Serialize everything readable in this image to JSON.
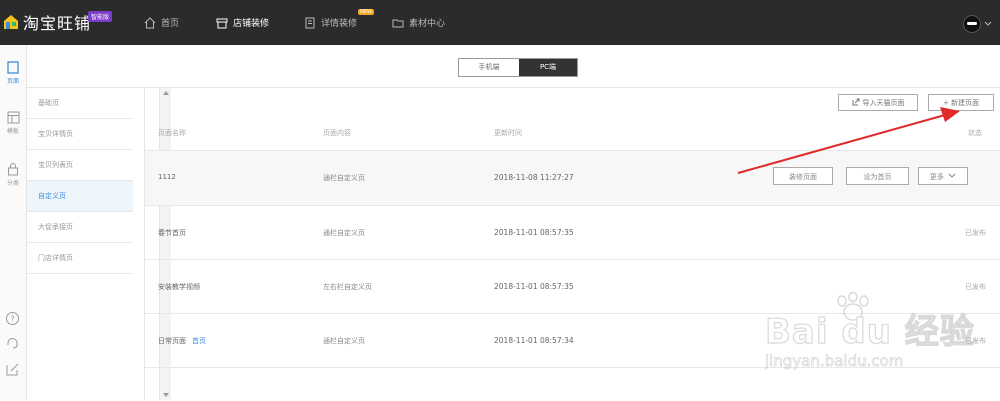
{
  "brand": {
    "name": "淘宝旺铺",
    "badge": "智能版"
  },
  "topnav": [
    {
      "label": "首页",
      "icon": "home-icon",
      "active": false
    },
    {
      "label": "店铺装修",
      "icon": "store-icon",
      "active": true
    },
    {
      "label": "详情装修",
      "icon": "document-icon",
      "active": false,
      "badge": "NEW"
    },
    {
      "label": "素材中心",
      "icon": "folder-icon",
      "active": false
    }
  ],
  "rail": [
    {
      "label": "页面",
      "icon": "page-icon",
      "active": true
    },
    {
      "label": "模板",
      "icon": "template-icon",
      "active": false
    },
    {
      "label": "分类",
      "icon": "bag-icon",
      "active": false
    }
  ],
  "rail_bottom_icons": [
    "help-icon",
    "headset-icon",
    "edit-icon"
  ],
  "device_switch": {
    "mobile": "手机端",
    "pc": "PC端",
    "selected": "pc"
  },
  "page_types": [
    "基础页",
    "宝贝详情页",
    "宝贝列表页",
    "自定义页",
    "大促承接页",
    "门店详情页"
  ],
  "page_types_active": "自定义页",
  "actions": {
    "import_label": "导入天猫页面",
    "new_label": "+ 新建页面"
  },
  "table": {
    "headers": {
      "name": "页面名称",
      "content": "页面内容",
      "updated": "更新时间",
      "status": "状态"
    },
    "rows": [
      {
        "name": "1112",
        "tag": "",
        "content": "通栏自定义页",
        "updated": "2018-11-08 11:27:27",
        "status": "",
        "hovered": true
      },
      {
        "name": "春节首页",
        "tag": "",
        "content": "通栏自定义页",
        "updated": "2018-11-01 08:57:35",
        "status": "已发布"
      },
      {
        "name": "安装教学视频",
        "tag": "",
        "content": "左右栏自定义页",
        "updated": "2018-11-01 08:57:35",
        "status": "已发布"
      },
      {
        "name": "日常页面",
        "tag": "首页",
        "content": "通栏自定义页",
        "updated": "2018-11-01 08:57:34",
        "status": "已发布"
      }
    ],
    "row_actions": {
      "decorate": "装修页面",
      "set_home": "设为首页",
      "more": "更多"
    }
  },
  "watermark": {
    "main": "Bai du 经验",
    "sub": "jingyan.baidu.com"
  },
  "colors": {
    "topbar": "#2b2b2b",
    "accent": "#3b8ee0",
    "annotation": "#e02a2a",
    "badge": "#7b3cc8"
  }
}
